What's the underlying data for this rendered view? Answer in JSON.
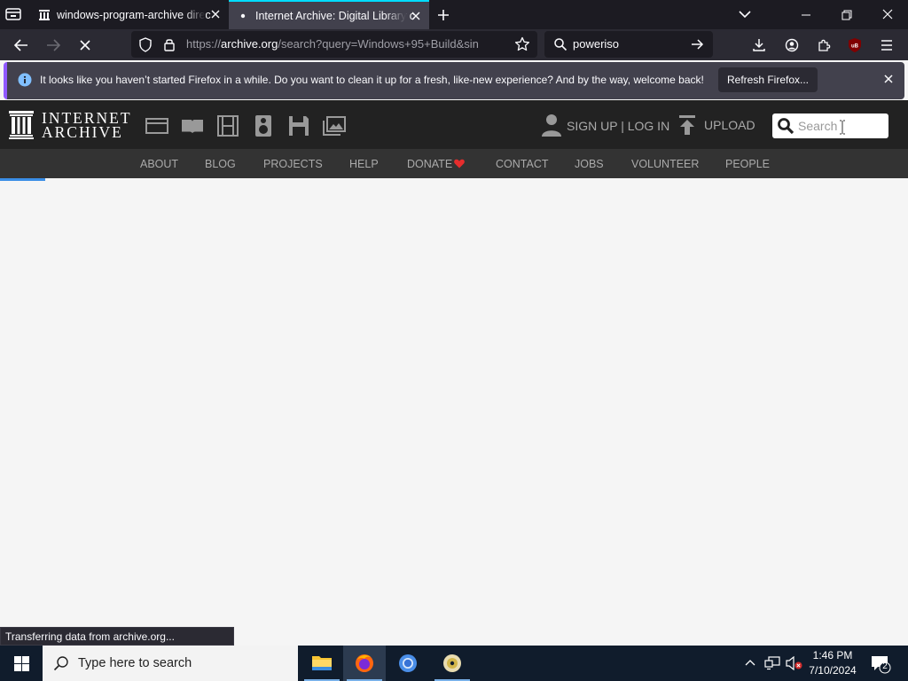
{
  "browser": {
    "tabs": [
      {
        "title": "windows-program-archive direc",
        "active": false
      },
      {
        "title": "Internet Archive: Digital Library c",
        "active": true
      }
    ],
    "url": {
      "prefix": "https://",
      "domain": "archive.org",
      "path": "/search?query=Windows+95+Build&sin"
    },
    "search_value": "poweriso",
    "notification": {
      "message": "It looks like you haven’t started Firefox in a while. Do you want to clean it up for a fresh, like-new experience? And by the way, welcome back!",
      "button_label": "Refresh Firefox..."
    },
    "status_text": "Transferring data from archive.org...",
    "accent_color": "#00ddff",
    "extension_badge": "uB"
  },
  "site": {
    "logo": {
      "line1": "INTERNET",
      "line2": "ARCHIVE"
    },
    "media_icons": [
      "web-icon",
      "texts-icon",
      "video-icon",
      "audio-icon",
      "software-icon",
      "images-icon"
    ],
    "signup_label": "SIGN UP | LOG IN",
    "upload_label": "UPLOAD",
    "search_placeholder": "Search",
    "nav": [
      "ABOUT",
      "BLOG",
      "PROJECTS",
      "HELP",
      "DONATE",
      "CONTACT",
      "JOBS",
      "VOLUNTEER",
      "PEOPLE"
    ],
    "donate_heart_color": "#e62d2d"
  },
  "taskbar": {
    "search_placeholder": "Type here to search",
    "time": "1:46 PM",
    "date": "7/10/2024",
    "notification_count": "2"
  }
}
